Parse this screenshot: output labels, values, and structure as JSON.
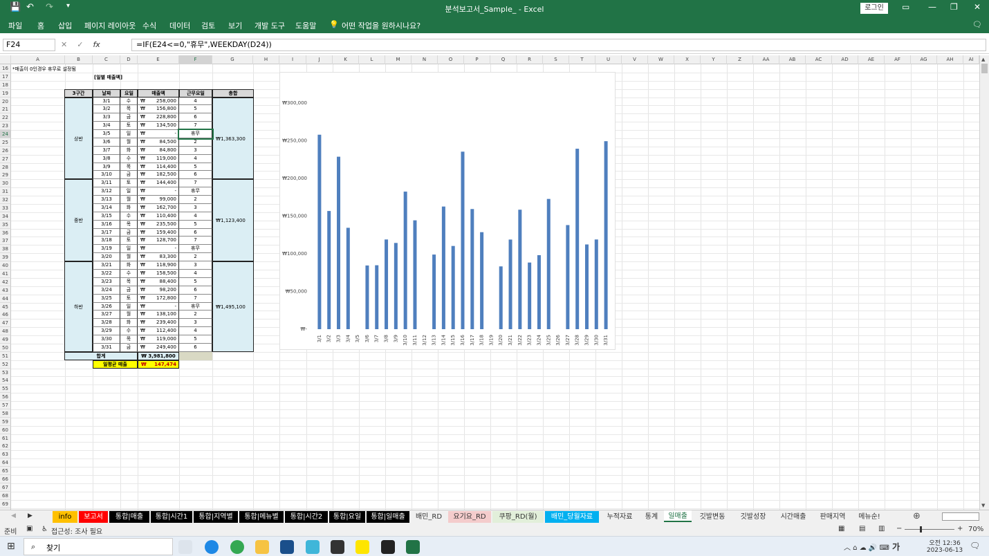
{
  "app": {
    "title": "분석보고서_Sample_  -  Excel",
    "login": "로그인"
  },
  "ribbon": {
    "tabs": [
      "파일",
      "홈",
      "삽입",
      "페이지 레이아웃",
      "수식",
      "데이터",
      "검토",
      "보기",
      "개발 도구",
      "도움말"
    ],
    "tell_me": "어떤 작업을 원하시나요?"
  },
  "formula_bar": {
    "cell_ref": "F24",
    "formula": "=IF(E24<=0,\"휴무\",WEEKDAY(D24))"
  },
  "columns": [
    "A",
    "B",
    "C",
    "D",
    "E",
    "F",
    "G",
    "H",
    "I",
    "J",
    "K",
    "L",
    "M",
    "N",
    "O",
    "P",
    "Q",
    "R",
    "S",
    "T",
    "U",
    "V",
    "W",
    "X",
    "Y",
    "Z",
    "AA",
    "AB",
    "AC",
    "AD",
    "AE",
    "AF",
    "AG",
    "AH",
    "AI"
  ],
  "sheet": {
    "note": "*매출이 0인경우 휴무로 설정됨",
    "section_title": "[일별 매출액]",
    "headers": [
      "3구간",
      "날짜",
      "요일",
      "매출액",
      "근무요일",
      "총합"
    ],
    "currency": "₩",
    "rows": [
      {
        "date": "3/1",
        "dow": "수",
        "sales": "258,000",
        "work": "4"
      },
      {
        "date": "3/2",
        "dow": "목",
        "sales": "156,800",
        "work": "5"
      },
      {
        "date": "3/3",
        "dow": "금",
        "sales": "228,800",
        "work": "6"
      },
      {
        "date": "3/4",
        "dow": "토",
        "sales": "134,500",
        "work": "7"
      },
      {
        "date": "3/5",
        "dow": "일",
        "sales": "-",
        "work": "휴무"
      },
      {
        "date": "3/6",
        "dow": "월",
        "sales": "84,500",
        "work": "2"
      },
      {
        "date": "3/7",
        "dow": "화",
        "sales": "84,800",
        "work": "3"
      },
      {
        "date": "3/8",
        "dow": "수",
        "sales": "119,000",
        "work": "4"
      },
      {
        "date": "3/9",
        "dow": "목",
        "sales": "114,400",
        "work": "5"
      },
      {
        "date": "3/10",
        "dow": "금",
        "sales": "182,500",
        "work": "6"
      },
      {
        "date": "3/11",
        "dow": "토",
        "sales": "144,400",
        "work": "7"
      },
      {
        "date": "3/12",
        "dow": "일",
        "sales": "-",
        "work": "휴무"
      },
      {
        "date": "3/13",
        "dow": "월",
        "sales": "99,000",
        "work": "2"
      },
      {
        "date": "3/14",
        "dow": "화",
        "sales": "162,700",
        "work": "3"
      },
      {
        "date": "3/15",
        "dow": "수",
        "sales": "110,400",
        "work": "4"
      },
      {
        "date": "3/16",
        "dow": "목",
        "sales": "235,500",
        "work": "5"
      },
      {
        "date": "3/17",
        "dow": "금",
        "sales": "159,400",
        "work": "6"
      },
      {
        "date": "3/18",
        "dow": "토",
        "sales": "128,700",
        "work": "7"
      },
      {
        "date": "3/19",
        "dow": "일",
        "sales": "-",
        "work": "휴무"
      },
      {
        "date": "3/20",
        "dow": "월",
        "sales": "83,300",
        "work": "2"
      },
      {
        "date": "3/21",
        "dow": "화",
        "sales": "118,900",
        "work": "3"
      },
      {
        "date": "3/22",
        "dow": "수",
        "sales": "158,500",
        "work": "4"
      },
      {
        "date": "3/23",
        "dow": "목",
        "sales": "88,400",
        "work": "5"
      },
      {
        "date": "3/24",
        "dow": "금",
        "sales": "98,200",
        "work": "6"
      },
      {
        "date": "3/25",
        "dow": "토",
        "sales": "172,800",
        "work": "7"
      },
      {
        "date": "3/26",
        "dow": "일",
        "sales": "-",
        "work": "휴무"
      },
      {
        "date": "3/27",
        "dow": "월",
        "sales": "138,100",
        "work": "2"
      },
      {
        "date": "3/28",
        "dow": "화",
        "sales": "239,400",
        "work": "3"
      },
      {
        "date": "3/29",
        "dow": "수",
        "sales": "112,400",
        "work": "4"
      },
      {
        "date": "3/30",
        "dow": "목",
        "sales": "119,000",
        "work": "5"
      },
      {
        "date": "3/31",
        "dow": "금",
        "sales": "249,400",
        "work": "6"
      }
    ],
    "sections": [
      {
        "label": "상반",
        "total": "1,363,300"
      },
      {
        "label": "중반",
        "total": "1,123,400"
      },
      {
        "label": "하반",
        "total": "1,495,100"
      }
    ],
    "sum_label": "합계",
    "sum_value": "3,981,800",
    "avg_label": "일평균 매출",
    "avg_value": "147,474"
  },
  "chart_data": {
    "type": "bar",
    "categories": [
      "3/1",
      "3/2",
      "3/3",
      "3/4",
      "3/5",
      "3/6",
      "3/7",
      "3/8",
      "3/9",
      "3/10",
      "3/11",
      "3/12",
      "3/13",
      "3/14",
      "3/15",
      "3/16",
      "3/17",
      "3/18",
      "3/19",
      "3/20",
      "3/21",
      "3/22",
      "3/23",
      "3/24",
      "3/25",
      "3/26",
      "3/27",
      "3/28",
      "3/29",
      "3/30",
      "3/31"
    ],
    "values": [
      258000,
      156800,
      228800,
      134500,
      0,
      84500,
      84800,
      119000,
      114400,
      182500,
      144400,
      0,
      99000,
      162700,
      110400,
      235500,
      159400,
      128700,
      0,
      83300,
      118900,
      158500,
      88400,
      98200,
      172800,
      0,
      138100,
      239400,
      112400,
      119000,
      249400
    ],
    "ylim": [
      0,
      300000
    ],
    "yticks": [
      "₩300,000",
      "₩250,000",
      "₩200,000",
      "₩150,000",
      "₩100,000",
      "₩50,000",
      "₩-"
    ],
    "color": "#4f7fbe",
    "grid": false
  },
  "sheet_tabs": [
    {
      "label": "info",
      "bg": "#ffc000",
      "fg": "#000"
    },
    {
      "label": "보고서",
      "bg": "#ff0000",
      "fg": "#fff"
    },
    {
      "label": "통합|매출",
      "bg": "#000000",
      "fg": "#fff"
    },
    {
      "label": "통합|시간1",
      "bg": "#000000",
      "fg": "#fff"
    },
    {
      "label": "통합|지역별",
      "bg": "#000000",
      "fg": "#fff"
    },
    {
      "label": "통합|메뉴별",
      "bg": "#000000",
      "fg": "#fff"
    },
    {
      "label": "통합|시간2",
      "bg": "#000000",
      "fg": "#fff"
    },
    {
      "label": "통합|요일",
      "bg": "#000000",
      "fg": "#fff"
    },
    {
      "label": "통합|일매출",
      "bg": "#000000",
      "fg": "#fff"
    },
    {
      "label": "배민_RD",
      "bg": "#f0f0f0",
      "fg": "#333"
    },
    {
      "label": "요기요_RD",
      "bg": "#f4cccc",
      "fg": "#333"
    },
    {
      "label": "쿠팡_RD(월)",
      "bg": "#e2efda",
      "fg": "#333"
    },
    {
      "label": "배민_당월자료",
      "bg": "#00b0f0",
      "fg": "#fff"
    },
    {
      "label": "누적자료",
      "bg": "#f0f0f0",
      "fg": "#333"
    },
    {
      "label": "통계",
      "bg": "#f0f0f0",
      "fg": "#333"
    },
    {
      "label": "일매출",
      "bg": "#ffffff",
      "fg": "#217346"
    },
    {
      "label": "깃발변동",
      "bg": "#f0f0f0",
      "fg": "#333"
    },
    {
      "label": "깃발성장",
      "bg": "#f0f0f0",
      "fg": "#333"
    },
    {
      "label": "시간매출",
      "bg": "#f0f0f0",
      "fg": "#333"
    },
    {
      "label": "판매지역",
      "bg": "#f0f0f0",
      "fg": "#333"
    },
    {
      "label": "메뉴순!",
      "bg": "#f0f0f0",
      "fg": "#333"
    }
  ],
  "status": {
    "ready": "준비",
    "accessibility": "접근성: 조사 필요",
    "zoom": "70%"
  },
  "taskbar": {
    "search": "찾기",
    "ime": "가",
    "time": "오전 12:36",
    "date": "2023-06-13"
  }
}
